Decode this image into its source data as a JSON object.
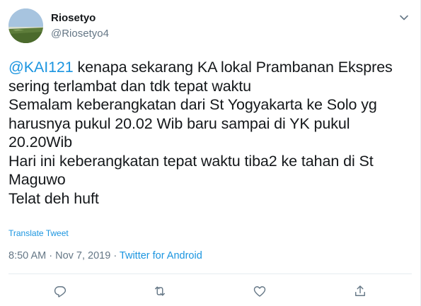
{
  "user": {
    "name": "Riosetyo",
    "handle": "@Riosetyo4"
  },
  "tweet": {
    "mention": "@KAI121",
    "lines": [
      " kenapa sekarang KA lokal Prambanan Ekspres",
      "sering terlambat dan tdk tepat waktu",
      "Semalam keberangkatan dari St Yogyakarta ke Solo yg",
      "harusnya pukul 20.02 Wib baru sampai di YK pukul",
      "20.20Wib",
      "Hari ini keberangkatan tepat waktu tiba2 ke tahan di St",
      "Maguwo",
      "Telat deh huft"
    ],
    "translate_label": "Translate Tweet"
  },
  "meta": {
    "time": "8:50 AM",
    "separator1": " · ",
    "date": "Nov 7, 2019",
    "separator2": " · ",
    "source": "Twitter for Android"
  },
  "icons": {
    "caret": "chevron-down-icon",
    "reply": "reply-icon",
    "retweet": "retweet-icon",
    "like": "heart-icon",
    "share": "share-icon"
  },
  "colors": {
    "link": "#1b95e0",
    "secondary": "#657786",
    "text": "#14171a",
    "divider": "#e6ecf0"
  }
}
